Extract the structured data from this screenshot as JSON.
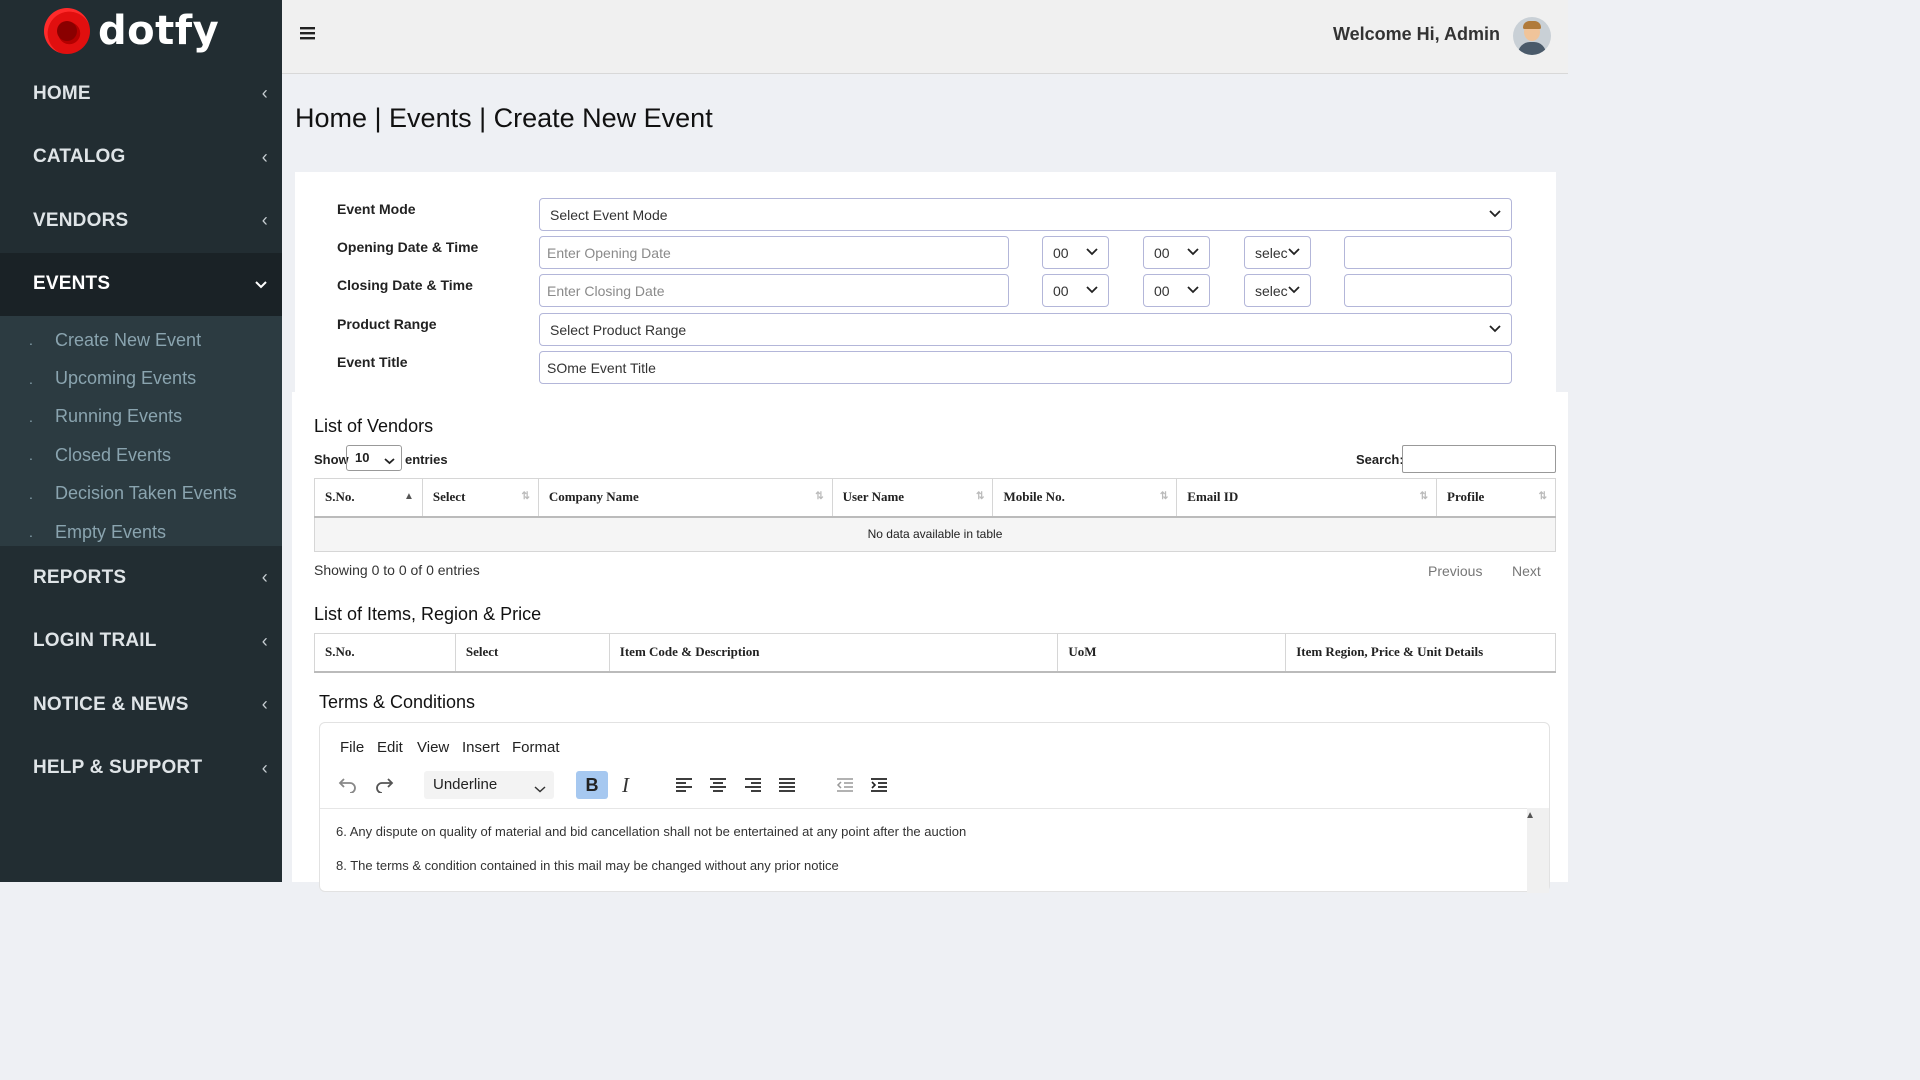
{
  "brand": {
    "logo_text": "dotfy"
  },
  "sidebar": {
    "items": [
      {
        "label": "HOME",
        "chevron": "‹"
      },
      {
        "label": "CATALOG",
        "chevron": "‹"
      },
      {
        "label": "VENDORS",
        "chevron": "‹"
      },
      {
        "label": "EVENTS",
        "chevron": "⌄"
      },
      {
        "label": "REPORTS",
        "chevron": "‹"
      },
      {
        "label": "LOGIN TRAIL",
        "chevron": "‹"
      },
      {
        "label": "NOTICE & NEWS",
        "chevron": "‹"
      },
      {
        "label": "HELP & SUPPORT",
        "chevron": "‹"
      }
    ],
    "events_submenu": [
      "Create New Event",
      "Upcoming Events",
      "Running Events",
      "Closed Events",
      "Decision Taken Events",
      "Empty Events"
    ]
  },
  "header": {
    "welcome": "Welcome Hi, Admin"
  },
  "page": {
    "title": "Home | Events | Create New Event"
  },
  "form": {
    "event_mode_label": "Event Mode",
    "event_mode_value": "Select Event Mode",
    "opening_label": "Opening Date & Time",
    "opening_placeholder": "Enter Opening Date",
    "closing_label": "Closing Date & Time",
    "closing_placeholder": "Enter Closing Date",
    "hour_value": "00",
    "minute_value": "00",
    "ampm_value": "selec",
    "product_range_label": "Product Range",
    "product_range_value": "Select Product Range",
    "event_title_label": "Event Title",
    "event_title_value": "SOme Event Title"
  },
  "vendors": {
    "title": "List of Vendors",
    "show_label": "Show",
    "entries_value": "10",
    "entries_label": "entries",
    "search_label": "Search:",
    "columns": [
      "S.No.",
      "Select",
      "Company Name",
      "User Name",
      "Mobile No.",
      "Email ID",
      "Profile"
    ],
    "empty_message": "No data available in table",
    "info": "Showing 0 to 0 of 0 entries",
    "previous": "Previous",
    "next": "Next"
  },
  "items": {
    "title": "List of Items, Region & Price",
    "columns": [
      "S.No.",
      "Select",
      "Item Code & Description",
      "UoM",
      "Item Region, Price & Unit Details"
    ]
  },
  "terms": {
    "title": "Terms & Conditions",
    "menu": [
      "File",
      "Edit",
      "View",
      "Insert",
      "Format"
    ],
    "format_select": "Underline",
    "bold": "B",
    "italic": "I",
    "lines": [
      "6. Any dispute on quality of material and bid cancellation shall not be entertained at any point after the auction",
      "8. The terms & condition contained in this mail may be changed without any prior notice"
    ]
  }
}
